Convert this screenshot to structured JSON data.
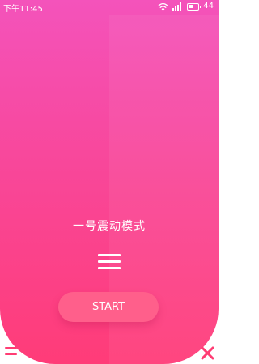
{
  "status_bar": {
    "time": "下午11:45",
    "battery": "44",
    "icons": [
      "wifi-icon",
      "signal-icon",
      "battery-icon"
    ]
  },
  "main": {
    "mode_title": "一号震动模式",
    "menu_icon": "menu-icon",
    "start_button": "START"
  },
  "bottom_controls": {
    "left_icon": "menu-icon",
    "right_icon": "close-icon"
  },
  "colors": {
    "gradient_top": "#f453bb",
    "gradient_bottom": "#ff3c78",
    "button": "#ff5f8b",
    "accent": "#ff3d74",
    "background": "#ffffff"
  }
}
